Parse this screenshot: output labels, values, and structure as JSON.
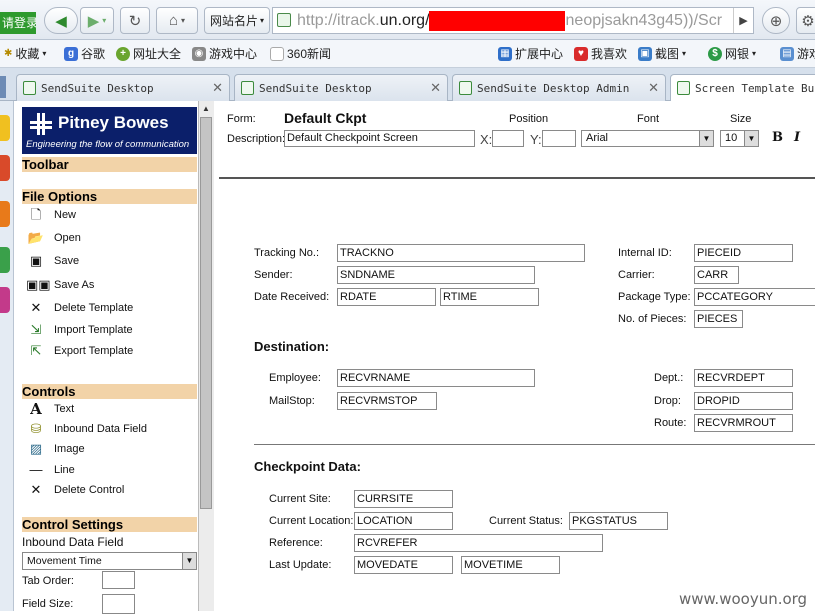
{
  "browser": {
    "login_label": "请登录",
    "fav_menu_label": "网站名片",
    "url_prefix": "http://itrack.",
    "url_host": "un.org/",
    "url_suffix": "neopjsakn43g45))/Scr",
    "bookmarks": [
      "收藏",
      "谷歌",
      "网址大全",
      "游戏中心",
      "360新闻",
      "扩展中心",
      "我喜欢",
      "截图",
      "网银",
      "游戏"
    ],
    "tabs": [
      "SendSuite Desktop",
      "SendSuite Desktop",
      "SendSuite Desktop Admin",
      "Screen Template Buil"
    ]
  },
  "leftpanel": {
    "brand": "Pitney Bowes",
    "tagline": "Engineering the flow of communication",
    "toolbar_title": "Toolbar",
    "file_options": {
      "title": "File Options",
      "items": [
        "New",
        "Open",
        "Save",
        "Save As",
        "Delete Template",
        "Import Template",
        "Export Template"
      ]
    },
    "controls": {
      "title": "Controls",
      "items": [
        "Text",
        "Inbound Data Field",
        "Image",
        "Line",
        "Delete Control"
      ]
    },
    "control_settings": {
      "title": "Control Settings",
      "subtitle": "Inbound Data Field",
      "select_value": "Movement Time",
      "tab_order_label": "Tab Order:",
      "field_size_label": "Field Size:"
    }
  },
  "formheader": {
    "form_label": "Form:",
    "form_name": "Default Ckpt",
    "desc_label": "Description:",
    "desc_value": "Default Checkpoint Screen",
    "position_label": "Position",
    "x_label": "X:",
    "y_label": "Y:",
    "font_label": "Font",
    "font_value": "Arial",
    "size_label": "Size",
    "size_value": "10",
    "bold_label": "B",
    "italic_label": "I"
  },
  "canvas": {
    "tracking_label": "Tracking No.:",
    "tracking_value": "TRACKNO",
    "sender_label": "Sender:",
    "sender_value": "SNDNAME",
    "date_label": "Date Received:",
    "date_value": "RDATE",
    "time_value": "RTIME",
    "internal_label": "Internal ID:",
    "internal_value": "PIECEID",
    "carrier_label": "Carrier:",
    "carrier_value": "CARR",
    "pkgtype_label": "Package Type:",
    "pkgtype_value": "PCCATEGORY",
    "pieces_label": "No. of Pieces:",
    "pieces_value": "PIECES",
    "destination_head": "Destination:",
    "employee_label": "Employee:",
    "employee_value": "RECVRNAME",
    "mailstop_label": "MailStop:",
    "mailstop_value": "RECVRMSTOP",
    "dept_label": "Dept.:",
    "dept_value": "RECVRDEPT",
    "drop_label": "Drop:",
    "drop_value": "DROPID",
    "route_label": "Route:",
    "route_value": "RECVRMROUT",
    "checkpoint_head": "Checkpoint Data:",
    "site_label": "Current Site:",
    "site_value": "CURRSITE",
    "location_label": "Current Location:",
    "location_value": "LOCATION",
    "status_label": "Current Status:",
    "status_value": "PKGSTATUS",
    "reference_label": "Reference:",
    "reference_value": "RCVREFER",
    "update_label": "Last Update:",
    "update_date": "MOVEDATE",
    "update_time": "MOVETIME"
  },
  "watermark": "www.wooyun.org"
}
